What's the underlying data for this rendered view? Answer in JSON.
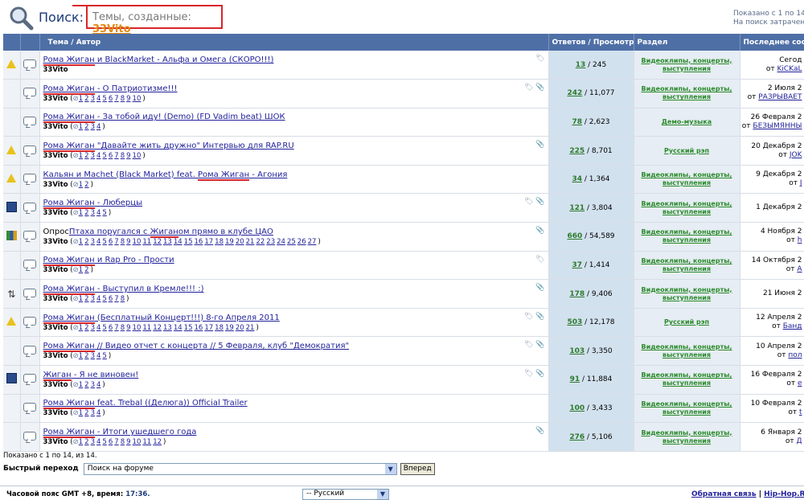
{
  "header": {
    "title": "Поиск:",
    "query_label": "Темы, созданные:",
    "query_user": "33Vito",
    "shown": "Показано с 1 по 14,",
    "time": "На поиск затрачено"
  },
  "columns": {
    "topic": "Тема / Автор",
    "replies": "Ответов / Просмотров",
    "forum": "Раздел",
    "last": "Последнее сооб"
  },
  "rows": [
    {
      "icon": "warning",
      "prefix": "",
      "title": "Рома Жиган и BlackMarket - Альфа и Омега (СКОРО!!!)",
      "author": "33Vito",
      "pages": [],
      "tags": "tag",
      "replies": "13",
      "views": "245",
      "forum": "Видеоклипы, концерты, выступления",
      "date": "Сегод",
      "by": "KiCKaL"
    },
    {
      "icon": "none",
      "prefix": "",
      "title": "Рома Жиган - О Патриотизме!!!",
      "author": "33Vito",
      "pages": [
        "1",
        "2",
        "3",
        "4",
        "5",
        "6",
        "7",
        "8",
        "9",
        "10"
      ],
      "tags": "tag clip",
      "replies": "242",
      "views": "11,077",
      "forum": "Видеоклипы, концерты, выступления",
      "date": "2 Июля 2",
      "by": "РАЗРЫВАЕТ"
    },
    {
      "icon": "none",
      "prefix": "",
      "title": "Рома Жиган - За тобой иду! (Demo) (FD Vadim beat) ШОК",
      "author": "33Vito",
      "pages": [
        "1",
        "2",
        "3",
        "4"
      ],
      "tags": "",
      "replies": "78",
      "views": "2,623",
      "forum": "Демо-музыка",
      "date": "26 Февраля 2",
      "by": "БЕЗЫМЯННЫ"
    },
    {
      "icon": "warning",
      "prefix": "",
      "title": "Рома Жиган \"Давайте жить дружно\" Интервью для RAP.RU",
      "author": "33Vito",
      "pages": [
        "1",
        "2",
        "3",
        "4",
        "5",
        "6",
        "7",
        "8",
        "9",
        "10"
      ],
      "tags": "clip",
      "replies": "225",
      "views": "8,701",
      "forum": "Русский рэп",
      "date": "20 Декабря 2",
      "by": "JOK"
    },
    {
      "icon": "warning",
      "prefix": "",
      "title": "Кальян и Machet (Black Market) feat. Рома Жиган - Агония",
      "author": "33Vito",
      "pages": [
        "1",
        "2"
      ],
      "tags": "",
      "replies": "34",
      "views": "1,364",
      "forum": "Видеоклипы, концерты, выступления",
      "date": "9 Декабря 2",
      "by": "J"
    },
    {
      "icon": "film",
      "prefix": "",
      "title": "Рома Жиган - Люберцы",
      "author": "33Vito",
      "pages": [
        "1",
        "2",
        "3",
        "4",
        "5"
      ],
      "tags": "tag clip",
      "replies": "121",
      "views": "3,804",
      "forum": "Видеоклипы, концерты, выступления",
      "date": "1 Декабря 2",
      "by": ""
    },
    {
      "icon": "poll",
      "prefix": "Опрос",
      "title": "Птаха поругался с Жиганом прямо в клубе ЦАО",
      "author": "33Vito",
      "pages": [
        "1",
        "2",
        "3",
        "4",
        "5",
        "6",
        "7",
        "8",
        "9",
        "10",
        "11",
        "12",
        "13",
        "14",
        "15",
        "16",
        "17",
        "18",
        "19",
        "20",
        "21",
        "22",
        "23",
        "24",
        "25",
        "26",
        "27"
      ],
      "tags": "clip",
      "replies": "660",
      "views": "54,589",
      "forum": "Видеоклипы, концерты, выступления",
      "date": "4 Ноября 2",
      "by": "h"
    },
    {
      "icon": "none",
      "prefix": "",
      "title": "Рома Жиган и Rap Pro - Прости",
      "author": "33Vito",
      "pages": [
        "1",
        "2"
      ],
      "tags": "tag",
      "replies": "37",
      "views": "1,414",
      "forum": "Видеоклипы, концерты, выступления",
      "date": "14 Октября 2",
      "by": "A"
    },
    {
      "icon": "moved",
      "prefix": "",
      "title": "Рома Жиган - Выступил в Кремле!!! :)",
      "author": "33Vito",
      "pages": [
        "1",
        "2",
        "3",
        "4",
        "5",
        "6",
        "7",
        "8"
      ],
      "tags": "clip",
      "replies": "178",
      "views": "9,406",
      "forum": "Видеоклипы, концерты, выступления",
      "date": "21 Июня 2",
      "by": ""
    },
    {
      "icon": "warning",
      "prefix": "",
      "title": "Рома Жиган (Бесплатный Концерт!!!) 8-го Апреля 2011",
      "author": "33Vito",
      "pages": [
        "1",
        "2",
        "3",
        "4",
        "5",
        "6",
        "7",
        "8",
        "9",
        "10",
        "11",
        "12",
        "13",
        "14",
        "15",
        "16",
        "17",
        "18",
        "19",
        "20",
        "21"
      ],
      "tags": "tag clip",
      "replies": "503",
      "views": "12,178",
      "forum": "Русский рэп",
      "date": "12 Апреля 2",
      "by": "Банд"
    },
    {
      "icon": "none",
      "prefix": "",
      "title": "Рома Жиган // Видео отчет с концерта // 5 Февраля, клуб \"Демократия\"",
      "author": "33Vito",
      "pages": [
        "1",
        "2",
        "3",
        "4",
        "5"
      ],
      "tags": "tag clip",
      "replies": "103",
      "views": "3,350",
      "forum": "Видеоклипы, концерты, выступления",
      "date": "10 Апреля 2",
      "by": "пол"
    },
    {
      "icon": "film",
      "prefix": "",
      "title": "Жиган - Я не виновен!",
      "author": "33Vito",
      "pages": [
        "1",
        "2",
        "3",
        "4"
      ],
      "tags": "tag clip",
      "replies": "91",
      "views": "11,884",
      "forum": "Видеоклипы, концерты, выступления",
      "date": "16 Февраля 2",
      "by": "e"
    },
    {
      "icon": "none",
      "prefix": "",
      "title": "Рома Жиган feat. Trebal ((Делюга)) Official Trailer",
      "author": "33Vito",
      "pages": [
        "1",
        "2",
        "3",
        "4"
      ],
      "tags": "",
      "replies": "100",
      "views": "3,433",
      "forum": "Видеоклипы, концерты, выступления",
      "date": "10 Февраля 2",
      "by": "t"
    },
    {
      "icon": "none",
      "prefix": "",
      "title": "Рома Жиган - Итоги ушедшего года",
      "author": "33Vito",
      "pages": [
        "1",
        "2",
        "3",
        "4",
        "5",
        "6",
        "7",
        "8",
        "9",
        "10",
        "11",
        "12"
      ],
      "tags": "clip",
      "replies": "276",
      "views": "5,106",
      "forum": "Видеоклипы, концерты, выступления",
      "date": "6 Января 2",
      "by": "Д"
    }
  ],
  "footer": {
    "shown": "Показано с 1 по 14, из 14.",
    "jump_label": "Быстрый переход",
    "jump_value": "Поиск на форуме",
    "go_button": "Вперед",
    "timezone": "Часовой пояс GMT +8, время:",
    "time": "17:36.",
    "language": "-- Русский",
    "feedback": "Обратная связь",
    "site": "Hip-Hop.Ru"
  }
}
